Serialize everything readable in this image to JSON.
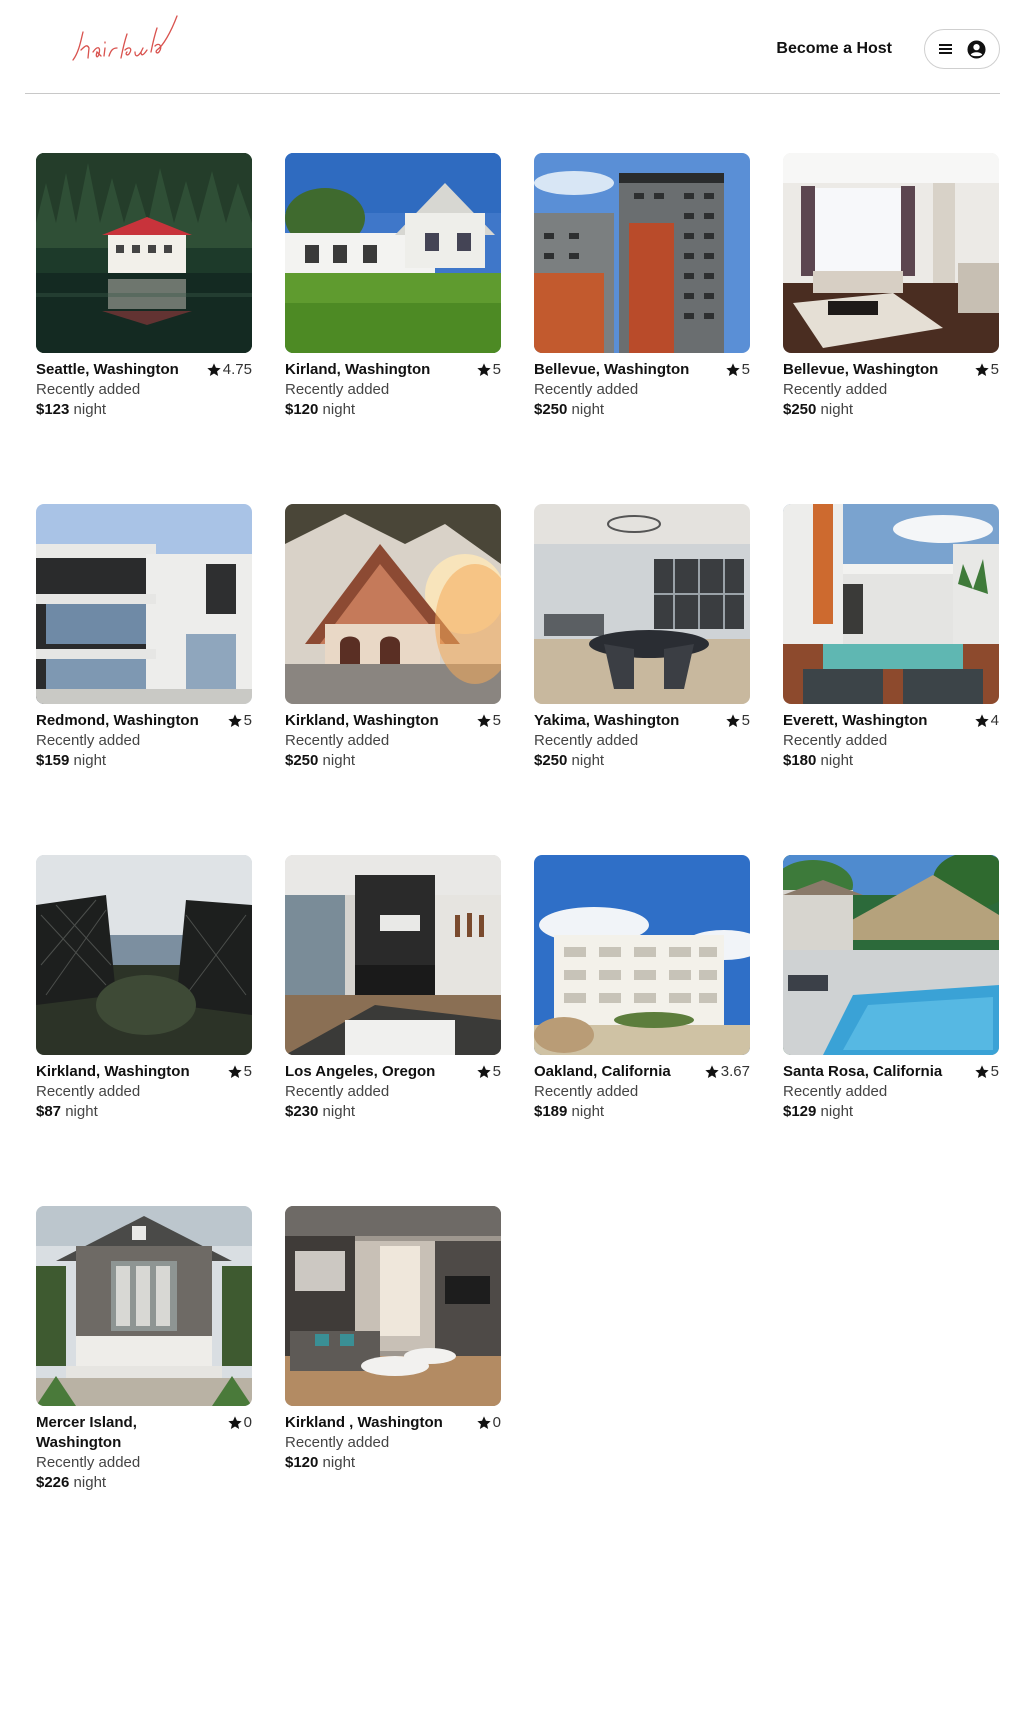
{
  "header": {
    "logo_text": "hairbnb",
    "host_label": "Become a Host",
    "menu_icon": "hamburger-icon",
    "user_icon": "user-circle-icon",
    "logo_color": "#d9534f"
  },
  "listings": [
    {
      "location": "Seattle, Washington",
      "rating": "4.75",
      "status": "Recently added",
      "price": "$123",
      "unit": "night",
      "scene": "lake-house"
    },
    {
      "location": "Kirland, Washington",
      "rating": "5",
      "status": "Recently added",
      "price": "$120",
      "unit": "night",
      "scene": "white-house-lawn"
    },
    {
      "location": "Bellevue, Washington",
      "rating": "5",
      "status": "Recently added",
      "price": "$250",
      "unit": "night",
      "scene": "tower-apartment"
    },
    {
      "location": "Bellevue, Washington",
      "rating": "5",
      "status": "Recently added",
      "price": "$250",
      "unit": "night",
      "scene": "bright-living-room"
    },
    {
      "location": "Redmond, Washington",
      "rating": "5",
      "status": "Recently added",
      "price": "$159",
      "unit": "night",
      "scene": "modern-house"
    },
    {
      "location": "Kirkland, Washington",
      "rating": "5",
      "status": "Recently added",
      "price": "$250",
      "unit": "night",
      "scene": "a-frame-sunset"
    },
    {
      "location": "Yakima, Washington",
      "rating": "5",
      "status": "Recently added",
      "price": "$250",
      "unit": "night",
      "scene": "dining-room"
    },
    {
      "location": "Everett, Washington",
      "rating": "4",
      "status": "Recently added",
      "price": "$180",
      "unit": "night",
      "scene": "courtyard-pool"
    },
    {
      "location": "Kirkland, Washington",
      "rating": "5",
      "status": "Recently added",
      "price": "$87",
      "unit": "night",
      "scene": "ocean-chairs"
    },
    {
      "location": "Los Angeles, Oregon",
      "rating": "5",
      "status": "Recently added",
      "price": "$230",
      "unit": "night",
      "scene": "loft-living"
    },
    {
      "location": "Oakland, California",
      "rating": "3.67",
      "status": "Recently added",
      "price": "$189",
      "unit": "night",
      "scene": "white-apartment"
    },
    {
      "location": "Santa Rosa, California",
      "rating": "5",
      "status": "Recently added",
      "price": "$129",
      "unit": "night",
      "scene": "tropical-pool"
    },
    {
      "location": "Mercer Island, Washington",
      "rating": "0",
      "status": "Recently added",
      "price": "$226",
      "unit": "night",
      "scene": "porch-house"
    },
    {
      "location": "Kirkland , Washington",
      "rating": "0",
      "status": "Recently added",
      "price": "$120",
      "unit": "night",
      "scene": "cozy-living"
    }
  ]
}
